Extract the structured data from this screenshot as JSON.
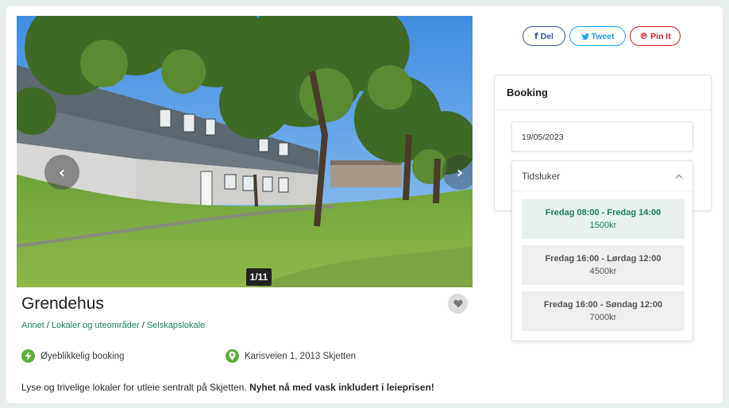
{
  "gallery": {
    "counter": "1/11",
    "prev_glyph": "‹",
    "next_glyph": "›"
  },
  "share": {
    "facebook": "Del",
    "twitter": "Tweet",
    "pinterest": "Pin It"
  },
  "listing": {
    "title": "Grendehus",
    "breadcrumb": [
      "Annet",
      "Lokaler og uteområder",
      "Selskapslokale"
    ],
    "features": [
      {
        "icon": "lightning-icon",
        "label": "Øyeblikkelig booking"
      },
      {
        "icon": "location-pin-icon",
        "label": "Karisveien 1, 2013 Skjetten"
      }
    ],
    "description": "Lyse og trivelige lokaler for utleie sentralt på Skjetten.",
    "description_bold": "Nyhet nå med vask inkludert i leieprisen!"
  },
  "booking": {
    "title": "Booking",
    "date": "19/05/2023",
    "timeslots_label": "Tidsluker",
    "timeslots": [
      {
        "when": "Fredag 08:00 - Fredag 14:00",
        "price": "1500kr",
        "selected": true
      },
      {
        "when": "Fredag 16:00 - Lørdag 12:00",
        "price": "4500kr",
        "selected": false
      },
      {
        "when": "Fredag 16:00 - Søndag 12:00",
        "price": "7000kr",
        "selected": false
      }
    ]
  },
  "colors": {
    "accent_green": "#1a7f5e",
    "icon_green": "#5cae3c",
    "facebook": "#3b5998",
    "twitter": "#1da1f2",
    "pinterest": "#cb2027"
  }
}
